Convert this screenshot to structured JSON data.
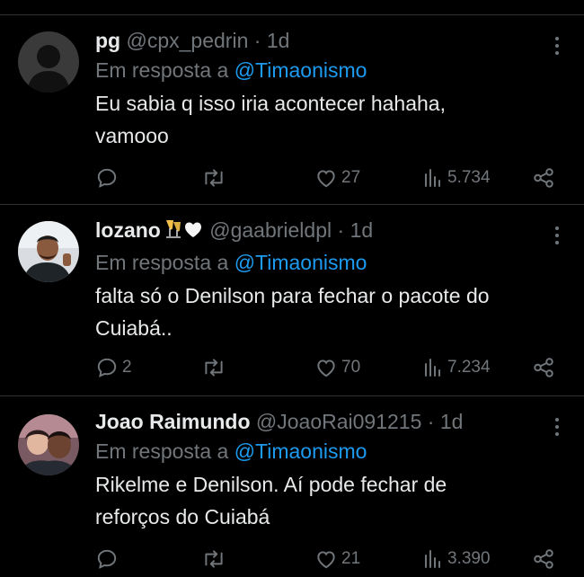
{
  "colors": {
    "background": "#000000",
    "text": "#e7e9ea",
    "muted": "#71767b",
    "accent": "#1d9bf0",
    "divider": "#2f3336"
  },
  "reply_prefix": "Em resposta a",
  "tweets": [
    {
      "name": "pg",
      "handle": "@cpx_pedrin",
      "separator": "·",
      "time": "1d",
      "reply_to": "@Timaonismo",
      "text": "Eu sabia q isso iria acontecer hahaha, vamooo",
      "replies": "",
      "retweets": "",
      "likes": "27",
      "views": "5.734",
      "avatar": "default-avatar"
    },
    {
      "name": "lozano",
      "name_emojis": "🥂🤍",
      "handle": "@gaabrieldpl",
      "separator": "·",
      "time": "1d",
      "reply_to": "@Timaonismo",
      "text": "falta só o Denilson para fechar o pacote do Cuiabá..",
      "replies": "2",
      "retweets": "",
      "likes": "70",
      "views": "7.234",
      "avatar": "photo-avatar"
    },
    {
      "name": "Joao Raimundo",
      "handle": "@JoaoRai091215",
      "separator": "·",
      "time": "1d",
      "reply_to": "@Timaonismo",
      "text": "Rikelme e Denilson. Aí pode fechar de reforços do Cuiabá",
      "replies": "",
      "retweets": "",
      "likes": "21",
      "views": "3.390",
      "avatar": "photo-avatar"
    }
  ]
}
